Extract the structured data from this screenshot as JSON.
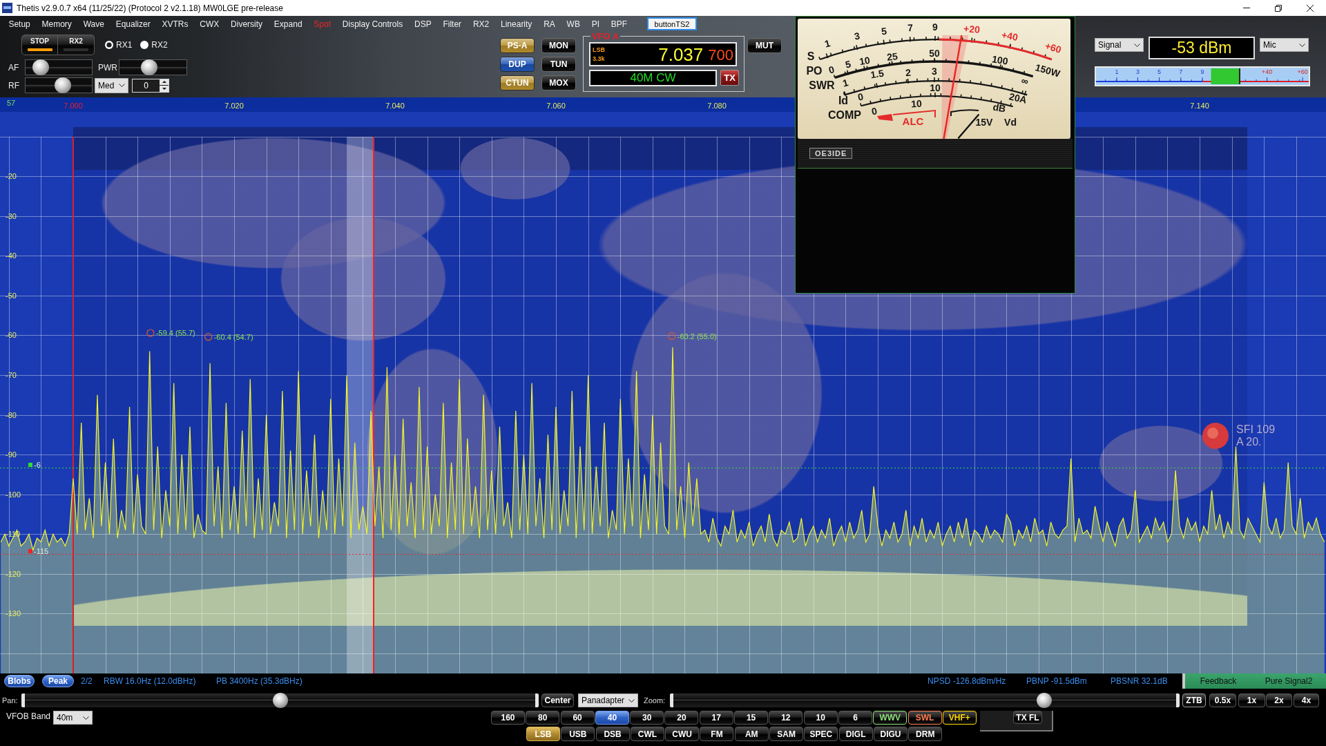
{
  "window": {
    "title": "Thetis v2.9.0.7 x64 (11/25/22) (Protocol 2 v2.1.18) MW0LGE pre-release"
  },
  "menu": [
    {
      "label": "Setup",
      "active": false
    },
    {
      "label": "Memory",
      "active": false
    },
    {
      "label": "Wave",
      "active": false
    },
    {
      "label": "Equalizer",
      "active": false
    },
    {
      "label": "XVTRs",
      "active": false
    },
    {
      "label": "CWX",
      "active": false
    },
    {
      "label": "Diversity",
      "active": false
    },
    {
      "label": "Expand",
      "active": false
    },
    {
      "label": "Spot",
      "active": true
    },
    {
      "label": "Display Controls",
      "active": false
    },
    {
      "label": "DSP",
      "active": false
    },
    {
      "label": "Filter",
      "active": false
    },
    {
      "label": "RX2",
      "active": false
    },
    {
      "label": "Linearity",
      "active": false
    },
    {
      "label": "RA",
      "active": false
    },
    {
      "label": "WB",
      "active": false
    },
    {
      "label": "PI",
      "active": false
    },
    {
      "label": "BPF",
      "active": false
    }
  ],
  "menu_button": {
    "label": "buttonTS2"
  },
  "power_buttons": [
    {
      "label": "STOP",
      "on": true
    },
    {
      "label": "RX2",
      "on": false
    }
  ],
  "receivers": [
    {
      "label": "RX1",
      "selected": true
    },
    {
      "label": "RX2",
      "selected": false
    }
  ],
  "sliders": [
    {
      "label": "AF",
      "level": 0.14
    },
    {
      "label": "PWR",
      "level": 0.42
    },
    {
      "label": "RF",
      "level": 0.58
    }
  ],
  "agc": {
    "value": "Med"
  },
  "gain_field": {
    "value": "0"
  },
  "function_buttons": [
    {
      "label": "PS-A",
      "on": true,
      "color": "#b8902c"
    },
    {
      "label": "MON",
      "on": false
    },
    {
      "label": "DUP",
      "on": true,
      "color": "#1f55b8"
    },
    {
      "label": "TUN",
      "on": false
    },
    {
      "label": "CTUN",
      "on": true,
      "color": "#b8902c"
    },
    {
      "label": "MOX",
      "on": false
    }
  ],
  "vfo": {
    "title": "VFO A",
    "mode": "LSB",
    "filter": "3.3k",
    "frequency": "7.037",
    "frequency_fine": "700",
    "band": "40M CW",
    "tx_button": "TX"
  },
  "mute_button": {
    "label": "MUT",
    "on": false
  },
  "meter": {
    "level": 0.58,
    "scales": [
      {
        "name": "S",
        "marks": [
          {
            "text": "1",
            "kind": "normal"
          },
          {
            "text": "3",
            "kind": "normal"
          },
          {
            "text": "5",
            "kind": "normal"
          },
          {
            "text": "7",
            "kind": "normal"
          },
          {
            "text": "9",
            "kind": "normal"
          },
          {
            "text": "+20",
            "kind": "over"
          },
          {
            "text": "+40",
            "kind": "over"
          },
          {
            "text": "+60",
            "kind": "over"
          }
        ]
      },
      {
        "name": "PO",
        "marks": [
          {
            "text": "0",
            "kind": "normal"
          },
          {
            "text": "5",
            "kind": "normal"
          },
          {
            "text": "10",
            "kind": "normal"
          },
          {
            "text": "25",
            "kind": "normal"
          },
          {
            "text": "50",
            "kind": "normal"
          },
          {
            "text": "100",
            "kind": "normal"
          },
          {
            "text": "150W",
            "kind": "normal"
          }
        ]
      },
      {
        "name": "SWR",
        "marks": [
          {
            "text": "1",
            "kind": "normal"
          },
          {
            "text": "1.5",
            "kind": "normal"
          },
          {
            "text": "2",
            "kind": "normal"
          },
          {
            "text": "3",
            "kind": "normal"
          },
          {
            "text": "∞",
            "kind": "normal"
          }
        ]
      },
      {
        "name": "Id",
        "marks": [
          {
            "text": "0",
            "kind": "normal"
          },
          {
            "text": "10",
            "kind": "normal"
          },
          {
            "text": "20A",
            "kind": "normal"
          }
        ]
      },
      {
        "name": "COMP",
        "marks": [
          {
            "text": "0",
            "kind": "normal"
          },
          {
            "text": "10",
            "kind": "normal"
          },
          {
            "text": "dB",
            "kind": "normal"
          }
        ]
      }
    ],
    "alc": "ALC",
    "vd": {
      "mark": "15V",
      "name": "Vd",
      "level": 0.68
    },
    "plate": "OE3IDE"
  },
  "signal_panel": {
    "source": "Signal",
    "reading": "-53 dBm",
    "input": "Mic",
    "bar": {
      "level": 0.67,
      "marks": [
        {
          "text": "1",
          "kind": "normal"
        },
        {
          "text": "3",
          "kind": "normal"
        },
        {
          "text": "5",
          "kind": "normal"
        },
        {
          "text": "7",
          "kind": "normal"
        },
        {
          "text": "9",
          "kind": "normal"
        },
        {
          "text": "+40",
          "kind": "over"
        },
        {
          "text": "+60",
          "kind": "over"
        }
      ]
    }
  },
  "spectrum": {
    "counter": "57",
    "level_tag": "-6",
    "chart_data": {
      "type": "line",
      "grid": true,
      "xlim": [
        6.9909,
        7.1557
      ],
      "ylim": [
        -163.3,
        24.33
      ],
      "x": [
        6.991,
        6.9915,
        6.992,
        6.9925,
        6.993,
        6.9935,
        6.994,
        6.9945,
        6.995,
        6.9955,
        6.996,
        6.9965,
        6.997,
        6.9975,
        6.998,
        6.9985,
        6.999,
        6.9995,
        7,
        7.0005,
        7.001,
        7.0015,
        7.002,
        7.0025,
        7.003,
        7.0035,
        7.004,
        7.0045,
        7.005,
        7.0055,
        7.006,
        7.0065,
        7.007,
        7.0075,
        7.008,
        7.0085,
        7.009,
        7.0095,
        7.01,
        7.0105,
        7.011,
        7.0115,
        7.012,
        7.0125,
        7.013,
        7.0135,
        7.014,
        7.0145,
        7.015,
        7.0155,
        7.016,
        7.0165,
        7.017,
        7.0175,
        7.018,
        7.0185,
        7.019,
        7.0195,
        7.02,
        7.0205,
        7.021,
        7.0215,
        7.022,
        7.0225,
        7.023,
        7.0235,
        7.024,
        7.0245,
        7.025,
        7.0255,
        7.026,
        7.0265,
        7.027,
        7.0275,
        7.028,
        7.0285,
        7.029,
        7.0295,
        7.03,
        7.0305,
        7.031,
        7.0315,
        7.032,
        7.0325,
        7.033,
        7.0335,
        7.034,
        7.0345,
        7.035,
        7.0355,
        7.036,
        7.0365,
        7.037,
        7.0375,
        7.038,
        7.0385,
        7.039,
        7.0395,
        7.04,
        7.0405,
        7.041,
        7.0415,
        7.042,
        7.0425,
        7.043,
        7.0435,
        7.044,
        7.0445,
        7.045,
        7.0455,
        7.046,
        7.0465,
        7.047,
        7.0475,
        7.048,
        7.0485,
        7.049,
        7.0495,
        7.05,
        7.0505,
        7.051,
        7.0515,
        7.052,
        7.0525,
        7.053,
        7.0535,
        7.054,
        7.0545,
        7.055,
        7.0555,
        7.056,
        7.0565,
        7.057,
        7.0575,
        7.058,
        7.0585,
        7.059,
        7.0595,
        7.06,
        7.0605,
        7.061,
        7.0615,
        7.062,
        7.0625,
        7.063,
        7.0635,
        7.064,
        7.0645,
        7.065,
        7.0655,
        7.066,
        7.0665,
        7.067,
        7.0675,
        7.068,
        7.0685,
        7.069,
        7.0695,
        7.07,
        7.0705,
        7.071,
        7.0715,
        7.072,
        7.0725,
        7.073,
        7.0735,
        7.074,
        7.0745,
        7.075,
        7.0755,
        7.076,
        7.0765,
        7.077,
        7.0775,
        7.078,
        7.0785,
        7.079,
        7.0795,
        7.08,
        7.0805,
        7.081,
        7.0815,
        7.082,
        7.0825,
        7.083,
        7.0835,
        7.084,
        7.0845,
        7.085,
        7.0855,
        7.086,
        7.0865,
        7.087,
        7.0875,
        7.088,
        7.0885,
        7.089,
        7.0895,
        7.09,
        7.0905,
        7.091,
        7.0915,
        7.092,
        7.0925,
        7.093,
        7.0935,
        7.094,
        7.0945,
        7.095,
        7.0955,
        7.096,
        7.0965,
        7.097,
        7.0975,
        7.098,
        7.0985,
        7.099,
        7.0995,
        7.1,
        7.1005,
        7.101,
        7.1015,
        7.102,
        7.1025,
        7.103,
        7.1035,
        7.104,
        7.1045,
        7.105,
        7.1055,
        7.106,
        7.1065,
        7.107,
        7.1075,
        7.108,
        7.1085,
        7.109,
        7.1095,
        7.11,
        7.1105,
        7.111,
        7.1115,
        7.112,
        7.1125,
        7.113,
        7.1135,
        7.114,
        7.1145,
        7.115,
        7.1155,
        7.116,
        7.1165,
        7.117,
        7.1175,
        7.118,
        7.1185,
        7.119,
        7.1195,
        7.12,
        7.1205,
        7.121,
        7.1215,
        7.122,
        7.1225,
        7.123,
        7.1235,
        7.124,
        7.1245,
        7.125,
        7.1255,
        7.126,
        7.1265,
        7.127,
        7.1275,
        7.128,
        7.1285,
        7.129,
        7.1295,
        7.13,
        7.1305,
        7.131,
        7.1315,
        7.132,
        7.1325,
        7.133,
        7.1335,
        7.134,
        7.1345,
        7.135,
        7.1355,
        7.136,
        7.1365,
        7.137,
        7.1375,
        7.138,
        7.1385,
        7.139,
        7.1395,
        7.14,
        7.1405,
        7.141,
        7.1415,
        7.142,
        7.1425,
        7.143,
        7.1435,
        7.144,
        7.1445,
        7.145,
        7.1455,
        7.146,
        7.1465,
        7.147,
        7.1475,
        7.148,
        7.1485,
        7.149,
        7.1495,
        7.15,
        7.1505,
        7.151,
        7.1515,
        7.152,
        7.1525,
        7.153,
        7.1535,
        7.154,
        7.1545,
        7.155,
        7.1555
      ],
      "series": [
        {
          "color": "#f4f42a",
          "values": [
            -112,
            -110,
            -113,
            -111,
            -109,
            -113,
            -112,
            -110,
            -114,
            -111,
            -112,
            -109,
            -113,
            -110,
            -112,
            -111,
            -113,
            -110,
            -96,
            -110,
            -82,
            -109,
            -101,
            -111,
            -75,
            -108,
            -92,
            -110,
            -86,
            -111,
            -104,
            -109,
            -78,
            -110,
            -95,
            -108,
            -110,
            -64,
            -109,
            -88,
            -111,
            -99,
            -108,
            -72,
            -110,
            -90,
            -109,
            -83,
            -111,
            -105,
            -109,
            -110,
            -67,
            -108,
            -93,
            -111,
            -77,
            -109,
            -98,
            -110,
            -84,
            -108,
            -71,
            -111,
            -96,
            -109,
            -80,
            -110,
            -102,
            -108,
            -74,
            -111,
            -89,
            -109,
            -69,
            -110,
            -94,
            -108,
            -85,
            -111,
            -99,
            -109,
            -76,
            -110,
            -91,
            -108,
            -70,
            -111,
            -87,
            -109,
            -103,
            -110,
            -79,
            -108,
            -93,
            -111,
            -68,
            -109,
            -90,
            -110,
            -81,
            -108,
            -97,
            -111,
            -73,
            -109,
            -88,
            -110,
            -100,
            -108,
            -77,
            -111,
            -92,
            -109,
            -71,
            -110,
            -86,
            -108,
            -98,
            -111,
            -75,
            -109,
            -94,
            -110,
            -83,
            -108,
            -102,
            -111,
            -79,
            -109,
            -90,
            -110,
            -72,
            -108,
            -96,
            -111,
            -85,
            -109,
            -78,
            -110,
            -99,
            -108,
            -74,
            -111,
            -88,
            -109,
            -70,
            -110,
            -93,
            -108,
            -82,
            -111,
            -104,
            -109,
            -76,
            -110,
            -91,
            -108,
            -69,
            -111,
            -95,
            -109,
            -80,
            -110,
            -87,
            -108,
            -110,
            -63,
            -109,
            -98,
            -111,
            -92,
            -108,
            -96,
            -110,
            -109,
            -112,
            -106,
            -111,
            -113,
            -108,
            -110,
            -104,
            -112,
            -109,
            -111,
            -107,
            -113,
            -110,
            -108,
            -112,
            -105,
            -111,
            -113,
            -109,
            -110,
            -107,
            -112,
            -111,
            -106,
            -113,
            -110,
            -108,
            -112,
            -109,
            -111,
            -106,
            -113,
            -110,
            -108,
            -112,
            -107,
            -111,
            -109,
            -104,
            -112,
            -110,
            -98,
            -108,
            -113,
            -109,
            -111,
            -107,
            -112,
            -110,
            -104,
            -113,
            -108,
            -111,
            -106,
            -112,
            -109,
            -111,
            -107,
            -113,
            -110,
            -108,
            -112,
            -107,
            -111,
            -106,
            -113,
            -109,
            -110,
            -112,
            -108,
            -111,
            -109,
            -110,
            -112,
            -105,
            -107,
            -113,
            -109,
            -111,
            -108,
            -112,
            -106,
            -110,
            -109,
            -113,
            -107,
            -110,
            -111,
            -109,
            -108,
            -91,
            -112,
            -106,
            -110,
            -109,
            -111,
            -103,
            -108,
            -112,
            -107,
            -110,
            -113,
            -108,
            -106,
            -111,
            -109,
            -99,
            -112,
            -110,
            -108,
            -111,
            -106,
            -109,
            -107,
            -112,
            -110,
            -94,
            -108,
            -111,
            -106,
            -109,
            -107,
            -112,
            -108,
            -110,
            -99,
            -109,
            -105,
            -111,
            -107,
            -110,
            -88,
            -109,
            -111,
            -106,
            -108,
            -110,
            -112,
            -97,
            -108,
            -110,
            -106,
            -111,
            -109,
            -92,
            -108,
            -110,
            -101,
            -111,
            -107,
            -109,
            -106,
            -110,
            -112
          ]
        }
      ],
      "xticks": [
        {
          "value": 7.0,
          "label": "7.000"
        },
        {
          "value": 7.02,
          "label": "7.020"
        },
        {
          "value": 7.04,
          "label": "7.040"
        },
        {
          "value": 7.06,
          "label": "7.060"
        },
        {
          "value": 7.08,
          "label": "7.080"
        },
        {
          "value": 7.14,
          "label": "7.140"
        }
      ],
      "yticks": [
        {
          "value": -20,
          "label": "-20"
        },
        {
          "value": -30,
          "label": "-30"
        },
        {
          "value": -40,
          "label": "-40"
        },
        {
          "value": -50,
          "label": "-50"
        },
        {
          "value": -60,
          "label": "-60"
        },
        {
          "value": -70,
          "label": "-70"
        },
        {
          "value": -80,
          "label": "-80"
        },
        {
          "value": -90,
          "label": "-90"
        },
        {
          "value": -100,
          "label": "-100"
        },
        {
          "value": -110,
          "label": "-110"
        },
        {
          "value": -120,
          "label": "-120"
        },
        {
          "value": -130,
          "label": "-130"
        }
      ],
      "ref_lines": [
        {
          "axis": "x",
          "value": 7.0,
          "color": "#e01e1e"
        },
        {
          "axis": "x",
          "value": 7.0373,
          "color": "#ff1e1e"
        },
        {
          "axis": "y",
          "value": -93.2,
          "color": "#33dd33"
        },
        {
          "axis": "y",
          "value": -115,
          "label": "-115",
          "color": "#ee2222"
        }
      ],
      "bands": [
        {
          "axis": "x",
          "from": 7.034,
          "to": 7.0373
        }
      ],
      "annotations": [
        {
          "x": 7.0096,
          "y": -59.4,
          "text": "-59.4 (55.7)"
        },
        {
          "x": 7.0168,
          "y": -60.4,
          "text": "-60.4 (54.7)"
        },
        {
          "x": 7.0744,
          "y": -60.2,
          "text": "-60.2 (55.0)"
        }
      ]
    },
    "solar": {
      "flux": "SFI 109",
      "a_index": "A 20."
    }
  },
  "status_bar": {
    "toggles": [
      {
        "label": "Blobs",
        "on": true
      },
      {
        "label": "Peak",
        "on": true
      }
    ],
    "page": "2/2",
    "readouts": [
      "RBW 16.0Hz (12.0dBHz)",
      "PB 3400Hz (35.3dBHz)",
      "NPSD -126.8dBm/Hz",
      "PBNP -91.5dBm",
      "PBSNR 32.1dB"
    ],
    "feedback": "Feedback",
    "pure_signal": "Pure Signal2"
  },
  "pan": {
    "label": "Pan:",
    "level": 0.5
  },
  "center_button": {
    "label": "Center"
  },
  "display_mode": {
    "value": "Panadapter"
  },
  "zoom": {
    "label": "Zoom:",
    "level": 0.745
  },
  "zoom_buttons": [
    {
      "label": "ZTB"
    },
    {
      "label": "0.5x"
    },
    {
      "label": "1x"
    },
    {
      "label": "2x"
    },
    {
      "label": "4x"
    }
  ],
  "vfob_band": {
    "label": "VFOB Band",
    "value": "40m"
  },
  "bands": [
    {
      "label": "160",
      "selected": false
    },
    {
      "label": "80",
      "selected": false
    },
    {
      "label": "60",
      "selected": false
    },
    {
      "label": "40",
      "selected": true
    },
    {
      "label": "30",
      "selected": false
    },
    {
      "label": "20",
      "selected": false
    },
    {
      "label": "17",
      "selected": false
    },
    {
      "label": "15",
      "selected": false
    },
    {
      "label": "12",
      "selected": false
    },
    {
      "label": "10",
      "selected": false
    },
    {
      "label": "6",
      "selected": false
    },
    {
      "label": "WWV",
      "selected": false,
      "color": "#8fe07a"
    },
    {
      "label": "SWL",
      "selected": false,
      "color": "#ff7f50"
    },
    {
      "label": "VHF+",
      "selected": false,
      "color": "#ffd700"
    }
  ],
  "tx_filter": {
    "label": "TX FL"
  },
  "modes": [
    {
      "label": "LSB",
      "selected": true
    },
    {
      "label": "USB",
      "selected": false
    },
    {
      "label": "DSB",
      "selected": false
    },
    {
      "label": "CWL",
      "selected": false
    },
    {
      "label": "CWU",
      "selected": false
    },
    {
      "label": "FM",
      "selected": false
    },
    {
      "label": "AM",
      "selected": false
    },
    {
      "label": "SAM",
      "selected": false
    },
    {
      "label": "SPEC",
      "selected": false
    },
    {
      "label": "DIGL",
      "selected": false
    },
    {
      "label": "DIGU",
      "selected": false
    },
    {
      "label": "DRM",
      "selected": false
    }
  ]
}
